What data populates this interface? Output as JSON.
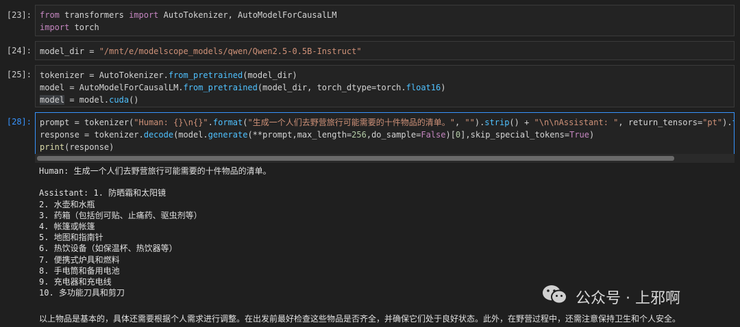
{
  "cells": [
    {
      "prompt": "[23]:",
      "lines": [
        [
          [
            "kw",
            "from"
          ],
          [
            "id",
            " transformers "
          ],
          [
            "kw",
            "import"
          ],
          [
            "id",
            " AutoTokenizer, AutoModelForCausalLM"
          ]
        ],
        [
          [
            "kw",
            "import"
          ],
          [
            "id",
            " torch"
          ]
        ]
      ]
    },
    {
      "prompt": "[24]:",
      "lines": [
        [
          [
            "id",
            "model_dir = "
          ],
          [
            "str",
            "\"/mnt/e/modelscope_models/qwen/Qwen2.5-0.5B-Instruct\""
          ]
        ]
      ]
    },
    {
      "prompt": "[25]:",
      "lines": [
        [
          [
            "id",
            "tokenizer = AutoTokenizer."
          ],
          [
            "mth",
            "from_pretrained"
          ],
          [
            "id",
            "(model_dir)"
          ]
        ],
        [
          [
            "id",
            "model = AutoModelForCausalLM."
          ],
          [
            "mth",
            "from_pretrained"
          ],
          [
            "id",
            "(model_dir, torch_dtype=torch."
          ],
          [
            "mth",
            "float16"
          ],
          [
            "id",
            ")"
          ]
        ],
        [
          [
            "hl",
            "model"
          ],
          [
            "id",
            " = model."
          ],
          [
            "mth",
            "cuda"
          ],
          [
            "id",
            "()"
          ]
        ]
      ]
    },
    {
      "prompt": "[28]:",
      "lines": [
        [
          [
            "id",
            "prompt = tokenizer("
          ],
          [
            "str",
            "\"Human: {}\\n{}\""
          ],
          [
            "id",
            "."
          ],
          [
            "mth",
            "format"
          ],
          [
            "id",
            "("
          ],
          [
            "str",
            "\"生成一个人们去野营旅行可能需要的十件物品的清单。\""
          ],
          [
            "id",
            ", "
          ],
          [
            "str",
            "\"\""
          ],
          [
            "id",
            ")."
          ],
          [
            "mth",
            "strip"
          ],
          [
            "id",
            "() + "
          ],
          [
            "str",
            "\"\\n\\nAssistant: \""
          ],
          [
            "id",
            ", return_tensors="
          ],
          [
            "str",
            "\"pt\""
          ],
          [
            "id",
            ")."
          ],
          [
            "mth",
            "to"
          ],
          [
            "id",
            "(mo"
          ]
        ],
        [
          [
            "id",
            "response = tokenizer."
          ],
          [
            "mth",
            "decode"
          ],
          [
            "id",
            "(model."
          ],
          [
            "mth",
            "generate"
          ],
          [
            "id",
            "(**prompt,max_length="
          ],
          [
            "num",
            "256"
          ],
          [
            "id",
            ",do_sample="
          ],
          [
            "kw",
            "False"
          ],
          [
            "id",
            ")["
          ],
          [
            "num",
            "0"
          ],
          [
            "id",
            "],skip_special_tokens="
          ],
          [
            "kw",
            "True"
          ],
          [
            "id",
            ")"
          ]
        ],
        [
          [
            "fn",
            "print"
          ],
          [
            "id",
            "(response)"
          ]
        ]
      ]
    }
  ],
  "output": {
    "lines": [
      "Human: 生成一个人们去野营旅行可能需要的十件物品的清单。",
      "",
      "Assistant: 1. 防晒霜和太阳镜",
      "2. 水壶和水瓶",
      "3. 药箱（包括创可贴、止痛药、驱虫剂等）",
      "4. 帐篷或帐篷",
      "5. 地图和指南针",
      "6. 热饮设备（如保温杯、热饮器等）",
      "7. 便携式炉具和燃料",
      "8. 手电筒和备用电池",
      "9. 充电器和充电线",
      "10. 多功能刀具和剪刀",
      "",
      "以上物品是基本的，具体还需要根据个人需求进行调整。在出发前最好检查这些物品是否齐全，并确保它们处于良好状态。此外，在野营过程中，还需注意保持卫生和个人安全。"
    ]
  },
  "watermark": {
    "text": "公众号 · 上邪啊",
    "icon": "wechat-icon"
  }
}
